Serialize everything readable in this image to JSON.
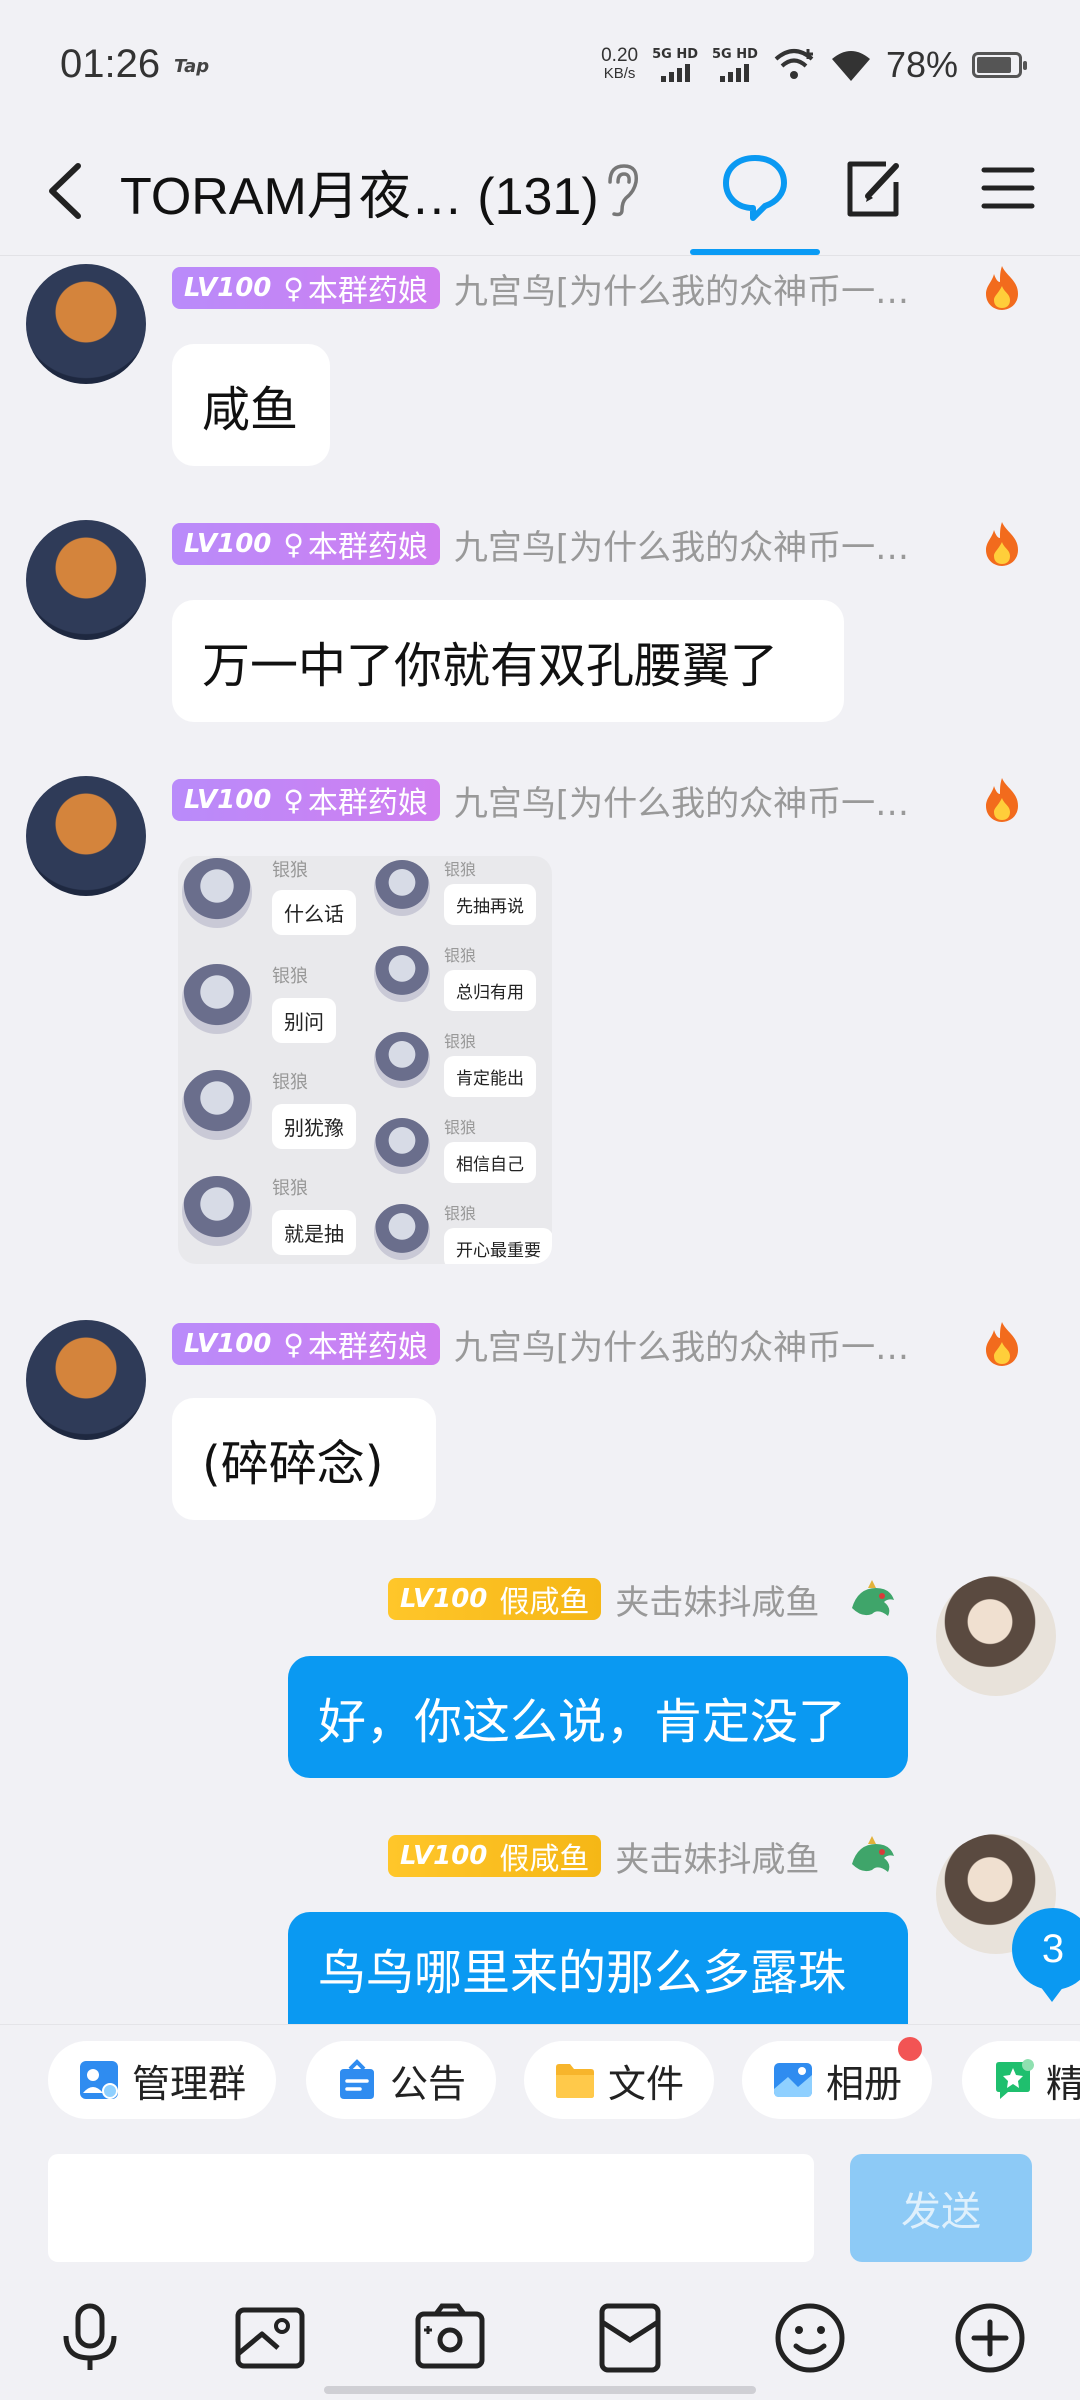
{
  "status_bar": {
    "time": "01:26",
    "app_tag": "Tap",
    "net_speed_value": "0.20",
    "net_speed_unit": "KB/s",
    "sim1": "5G HD",
    "sim2": "5G HD",
    "battery": "78%"
  },
  "header": {
    "title": "TORAM月夜… (131)"
  },
  "badges": {
    "lv": "LV100",
    "purple_title": "本群药娘",
    "yellow_title": "假咸鱼"
  },
  "users": {
    "left_nick": "九宫鸟[为什么我的众神币一…",
    "right_nick": "夹击妹抖咸鱼"
  },
  "messages": [
    {
      "text": "咸鱼"
    },
    {
      "text": "万一中了你就有双孔腰翼了"
    },
    {
      "text": ""
    },
    {
      "text": "(碎碎念)"
    },
    {
      "text": "好，你这么说，肯定没了"
    },
    {
      "text": "鸟鸟哪里来的那么多露珠"
    }
  ],
  "sticker": {
    "name": "银狼",
    "left_lines": [
      "什么话",
      "别问",
      "别犹豫",
      "就是抽"
    ],
    "right_lines": [
      "先抽再说",
      "总归有用",
      "肯定能出",
      "相信自己",
      "开心最重要"
    ]
  },
  "unread_count": "3",
  "quick_actions": [
    {
      "label": "管理群"
    },
    {
      "label": "公告"
    },
    {
      "label": "文件"
    },
    {
      "label": "相册"
    },
    {
      "label": "精"
    }
  ],
  "input": {
    "value": "",
    "send_label": "发送"
  },
  "colors": {
    "accent": "#0a99f2",
    "bubble_in": "#ffffff",
    "background": "#f1f1f5",
    "badge_purple": "#c084f5",
    "badge_yellow": "#fbbf24"
  }
}
